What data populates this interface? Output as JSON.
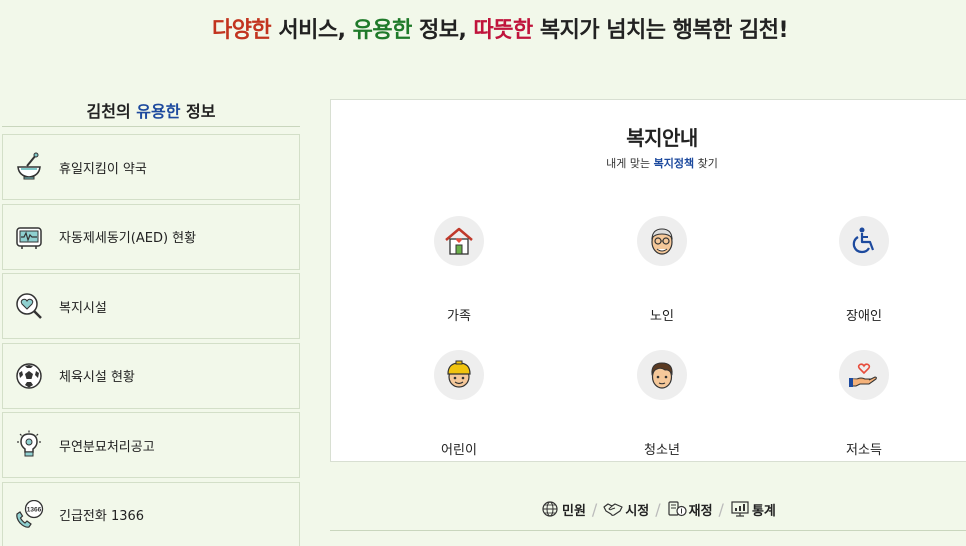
{
  "headline": {
    "part1": "다양한",
    "part2": " 서비스, ",
    "part3": "유용한",
    "part4": " 정보, ",
    "part5": "따뜻한",
    "part6": " 복지가 넘치는 행복한 김천!"
  },
  "info": {
    "title_prefix": "김천의 ",
    "title_highlight": "유용한",
    "title_suffix": " 정보",
    "items": [
      {
        "label": "휴일지킴이 약국",
        "icon": "mortar-pestle-icon"
      },
      {
        "label": "자동제세동기(AED) 현황",
        "icon": "defibrillator-icon"
      },
      {
        "label": "복지시설",
        "icon": "heart-magnifier-icon"
      },
      {
        "label": "체육시설 현황",
        "icon": "soccer-ball-icon"
      },
      {
        "label": "무연분묘처리공고",
        "icon": "lightbulb-icon"
      },
      {
        "label": "긴급전화 1366",
        "icon": "phone-1366-icon",
        "badge": "1366"
      }
    ]
  },
  "welfare": {
    "title": "복지안내",
    "sub_prefix": "내게 맞는 ",
    "sub_highlight": "복지정책",
    "sub_suffix": " 찾기",
    "categories": [
      {
        "label": "가족",
        "icon": "house-heart-icon"
      },
      {
        "label": "노인",
        "icon": "elderly-face-icon"
      },
      {
        "label": "장애인",
        "icon": "wheelchair-icon"
      },
      {
        "label": "어린이",
        "icon": "child-face-icon"
      },
      {
        "label": "청소년",
        "icon": "youth-face-icon"
      },
      {
        "label": "저소득",
        "icon": "hand-heart-icon"
      }
    ]
  },
  "bottom_links": [
    {
      "label": "민원",
      "icon": "globe-icon"
    },
    {
      "label": "시정",
      "icon": "handshake-icon"
    },
    {
      "label": "재정",
      "icon": "coins-icon"
    },
    {
      "label": "통계",
      "icon": "monitor-chart-icon"
    }
  ],
  "colors": {
    "background": "#f2f8ea",
    "accent_red": "#c2341f",
    "accent_green": "#1f7a2a",
    "accent_crimson": "#c0143c",
    "accent_blue": "#1d4a9e"
  }
}
